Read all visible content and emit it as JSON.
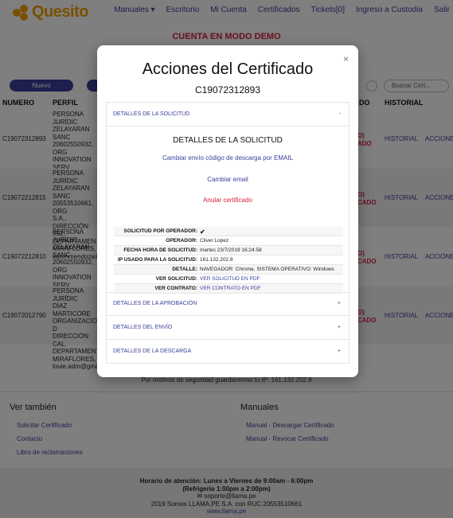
{
  "header": {
    "logo_text": "Quesito",
    "nav": [
      "Manuales ▾",
      "Escritorio",
      "Mi Cuenta",
      "Certificados",
      "Tickets[0]",
      "Ingreso a Custodia",
      "Salir"
    ],
    "demo_banner": "CUENTA EN MODO DEMO"
  },
  "toolbar": {
    "nuevo_label": "Nuevo",
    "search_placeholder": "Buscar Cert..."
  },
  "table": {
    "headers": {
      "numero": "NUMERO",
      "perfil": "PERFIL",
      "estado": "DO",
      "historial": "HISTORIAL"
    },
    "rows": [
      {
        "numero": "C19072312893",
        "perfil": [
          "PERSONA JURÍDIC",
          "ZELAYARAN SANC",
          "20602550932, ORG",
          "INNOVATION SERV",
          "SOLEDAD NRO. 44",
          "LIMA, PROVINCIA",
          "jorge@llama.pe 9"
        ],
        "estado": [
          "O)",
          "ADO"
        ],
        "historial": "HISTORIAL",
        "acciones": "ACCIONES"
      },
      {
        "numero": "C19072212815",
        "perfil": [
          "PERSONA JURÍDIC",
          "ZELAYARAN SANC",
          "20553510661, ORG",
          "S.A., DIRECCIÓN:",
          "902, DEPARTAMEN",
          "MIRAFLORES,",
          "karenmendoza@l"
        ],
        "estado": [
          "O)",
          "CADO"
        ],
        "historial": "HISTORIAL",
        "acciones": "ACCIONES"
      },
      {
        "numero": "C19072212810",
        "perfil": [
          "PERSONA JURÍDIC",
          "ZELAYARAN SANC",
          "20602550932, ORG",
          "INNOVATION SERV",
          "SOLEDAD NRO. 44",
          "LIMA, PROVINCIA",
          "jorge@llama.pe 9"
        ],
        "estado": [
          "O)",
          "CADO"
        ],
        "historial": "HISTORIAL",
        "acciones": "ACCIONES"
      },
      {
        "numero": "C19072012790",
        "perfil": [
          "PERSONA JURÍDIC",
          "DIAZ MARTICORE",
          "ORGANIZACION D",
          "DIRECCIÓN: CAL.",
          "DEPARTAMENTO:",
          "MIRAFLORES,",
          "louie.adm@gmail"
        ],
        "estado": [
          "O)",
          "CADO"
        ],
        "historial": "HISTORIAL",
        "acciones": "ACCIONES"
      }
    ]
  },
  "ip_notice": "Por motivos de seguridad guardaremos tu IP: 161.132.202.8",
  "see_also": {
    "title": "Ver también",
    "links": [
      "Solicitar Certificado",
      "Contacto",
      "Libro de reclamaciones"
    ]
  },
  "manuals": {
    "title": "Manuales",
    "links": [
      "Manual - Descargar Certificado",
      "Manual - Revocar Certificado"
    ]
  },
  "footer": {
    "hours": "Horario de atención: Lunes a Viernes de 9:00am - 6:00pm",
    "break": "(Refrigerio 1:00pm a 2:00pm)",
    "email": "soporte@llama.pe",
    "company": "2019 Somos LLAMA.PE S.A. con RUC 20553510661",
    "website": "www.llama.pe"
  },
  "modal": {
    "title": "Acciones del Certificado",
    "certificate_id": "C19072312893",
    "close": "×",
    "sections": {
      "solicitud": {
        "label": "DETALLES DE LA SOLICITUD",
        "sign": "-"
      },
      "aprobacion": {
        "label": "DETALLES DE LA APROBACIÓN",
        "sign": "+"
      },
      "envio": {
        "label": "DETALLES DEL ENVÍO",
        "sign": "+"
      },
      "descarga": {
        "label": "DETALLES DE LA DESCARGA",
        "sign": "+"
      }
    },
    "details": {
      "heading": "DETALLES DE LA SOLICITUD",
      "link_change_delivery": "Cambiar envío código de descarga por EMAIL",
      "link_change_email": "Cambiar email",
      "link_cancel": "Anular certificado",
      "rows": [
        {
          "label": "SOLICITUD POR OPERADOR:",
          "value": "✔",
          "type": "check"
        },
        {
          "label": "OPERADOR:",
          "value": "Cliver Lopez",
          "type": "text"
        },
        {
          "label": "FECHA HORA DE SOLICITUD:",
          "value": "martes 23/7/2019 16:24:58",
          "type": "text"
        },
        {
          "label": "IP USADO PARA LA SOLICITUD:",
          "value": "161.132.202.8",
          "type": "text"
        },
        {
          "label": "DETALLE:",
          "value": "NAVEGADOR: Chrome, SISTEMA OPERATIVO: Windows",
          "type": "text"
        },
        {
          "label": "VER SOLICITUD:",
          "value": "VER SOLICITUD EN PDF",
          "type": "link"
        },
        {
          "label": "VER CONTRATO:",
          "value": "VER CONTRATO EN PDF",
          "type": "link"
        }
      ]
    }
  }
}
